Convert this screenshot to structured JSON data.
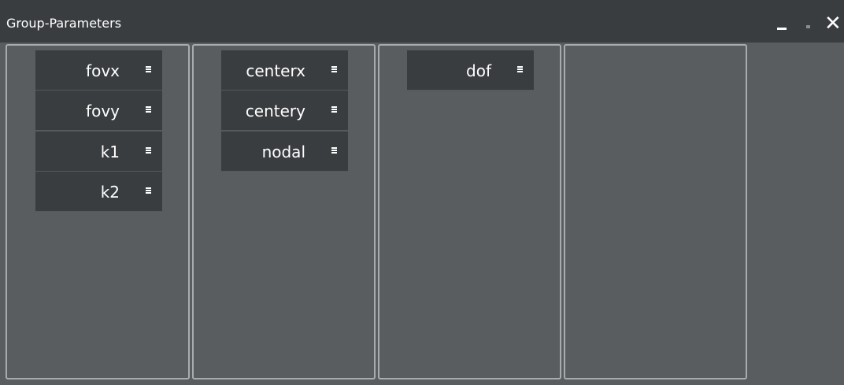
{
  "window": {
    "title": "Group-Parameters",
    "controls": [
      "minimize",
      "maximize",
      "close"
    ],
    "close_glyph": "✕"
  },
  "panels": [
    {
      "items": [
        {
          "label": "fovx",
          "icon": "menu-icon"
        },
        {
          "label": "fovy",
          "icon": "menu-icon"
        },
        {
          "label": "k1",
          "icon": "menu-icon"
        },
        {
          "label": "k2",
          "icon": "menu-icon"
        }
      ]
    },
    {
      "items": [
        {
          "label": "centerx",
          "icon": "menu-icon"
        },
        {
          "label": "centery",
          "icon": "menu-icon"
        },
        {
          "label": "nodal",
          "icon": "menu-icon"
        }
      ]
    },
    {
      "items": [
        {
          "label": "dof",
          "icon": "menu-icon"
        }
      ]
    },
    {
      "items": []
    }
  ],
  "colors": {
    "background": "#5a5d60",
    "titlebar": "#3a3d40",
    "item": "#3a3d40",
    "panel_border": "#a9acae",
    "text": "#ffffff"
  }
}
